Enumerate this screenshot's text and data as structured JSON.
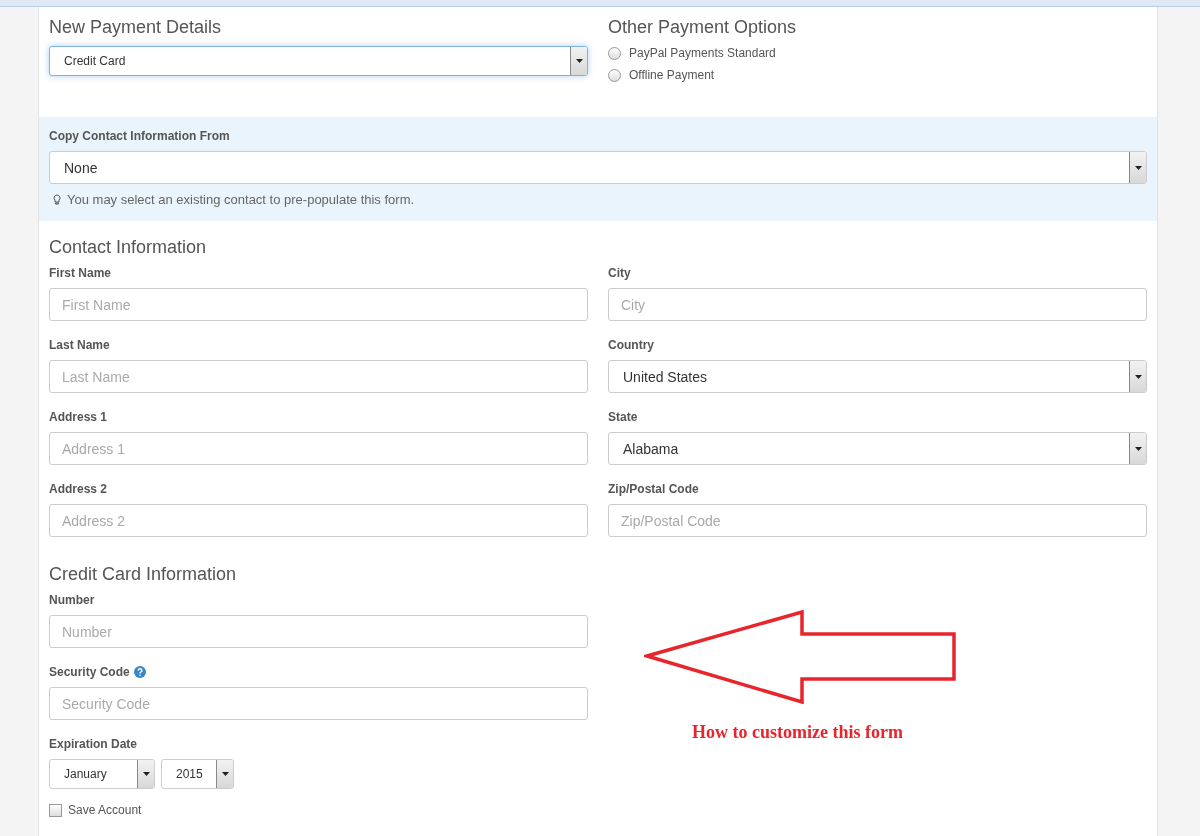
{
  "payment": {
    "title": "New Payment Details",
    "method": "Credit Card"
  },
  "other_options": {
    "title": "Other Payment Options",
    "options": [
      {
        "label": "PayPal Payments Standard",
        "selected": false
      },
      {
        "label": "Offline Payment",
        "selected": false
      }
    ]
  },
  "copy_contact": {
    "label": "Copy Contact Information From",
    "value": "None",
    "hint": "You may select an existing contact to pre-populate this form."
  },
  "contact": {
    "title": "Contact Information",
    "rows": [
      [
        {
          "label": "First Name",
          "kind": "input",
          "placeholder": "First Name"
        },
        {
          "label": "City",
          "kind": "input",
          "placeholder": "City"
        }
      ],
      [
        {
          "label": "Last Name",
          "kind": "input",
          "placeholder": "Last Name"
        },
        {
          "label": "Country",
          "kind": "select",
          "value": "United States"
        }
      ],
      [
        {
          "label": "Address 1",
          "kind": "input",
          "placeholder": "Address 1"
        },
        {
          "label": "State",
          "kind": "select",
          "value": "Alabama"
        }
      ],
      [
        {
          "label": "Address 2",
          "kind": "input",
          "placeholder": "Address 2"
        },
        {
          "label": "Zip/Postal Code",
          "kind": "input",
          "placeholder": "Zip/Postal Code"
        }
      ]
    ]
  },
  "credit_card": {
    "title": "Credit Card Information",
    "fields": [
      {
        "label": "Number",
        "placeholder": "Number",
        "help": false
      },
      {
        "label": "Security Code",
        "placeholder": "Security Code",
        "help": true
      }
    ],
    "expiration": {
      "label": "Expiration Date",
      "month": "January",
      "year": "2015"
    },
    "save_account": {
      "label": "Save Account",
      "checked": false
    }
  },
  "annotation": {
    "text": "How to customize this form"
  }
}
